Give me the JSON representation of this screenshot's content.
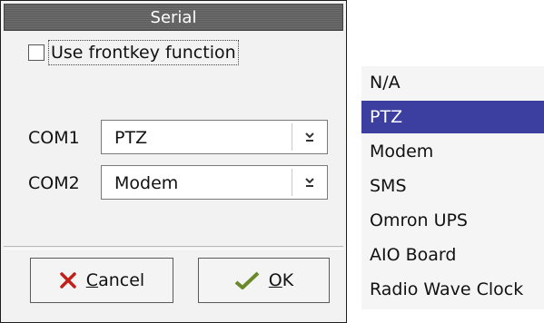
{
  "window": {
    "title": "Serial"
  },
  "checkbox": {
    "label": "Use frontkey function",
    "checked": false
  },
  "com1": {
    "label": "COM1",
    "value": "PTZ"
  },
  "com2": {
    "label": "COM2",
    "value": "Modem"
  },
  "buttons": {
    "cancel": {
      "mnemonic": "C",
      "rest": "ancel",
      "icon": "x-icon"
    },
    "ok": {
      "mnemonic": "O",
      "rest": "K",
      "icon": "check-icon"
    }
  },
  "dropdown": {
    "items": [
      "N/A",
      "PTZ",
      "Modem",
      "SMS",
      "Omron UPS",
      "AIO Board",
      "Radio Wave Clock"
    ],
    "selected": "PTZ"
  },
  "colors": {
    "selection": "#3d3fa0",
    "titlebar": "#666666"
  }
}
